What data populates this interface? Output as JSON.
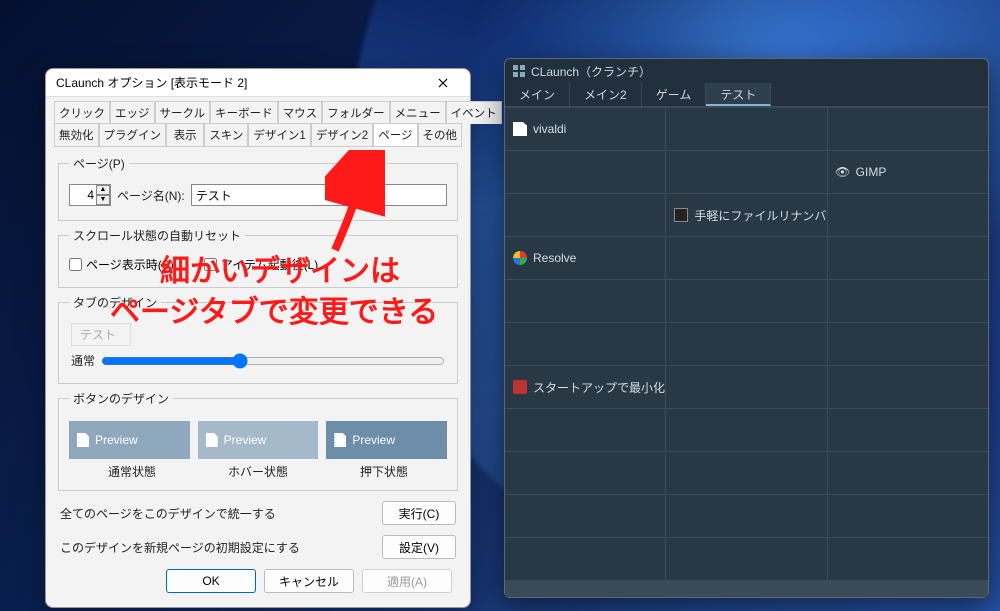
{
  "options": {
    "title": "CLaunch オプション [表示モード 2]",
    "tabs_row1": [
      "クリック",
      "エッジ",
      "サークル",
      "キーボード",
      "マウス",
      "フォルダー",
      "メニュー",
      "イベント"
    ],
    "tabs_row2": [
      "無効化",
      "プラグイン",
      "表示",
      "スキン",
      "デザイン1",
      "デザイン2",
      "ページ",
      "その他"
    ],
    "active_tab": "ページ",
    "page_group": {
      "legend": "ページ(P)",
      "number_value": "4",
      "name_label": "ページ名(N):",
      "name_value": "テスト"
    },
    "scroll_group": {
      "legend": "スクロール状態の自動リセット",
      "cb1": "ページ表示時(S)",
      "cb2": "アイテム起動後(L)"
    },
    "tabdesign_group": {
      "legend": "タブのデザイン",
      "disabled_preview": "テスト",
      "slider_label": "通常"
    },
    "btndesign_group": {
      "legend": "ボタンのデザイン",
      "preview_label": "Preview",
      "state_normal": "通常状態",
      "state_hover": "ホバー状態",
      "state_press": "押下状態"
    },
    "unify": {
      "text": "全てのページをこのデザインで統一する",
      "btn": "実行(C)"
    },
    "newpage": {
      "text": "このデザインを新規ページの初期設定にする",
      "btn": "設定(V)"
    },
    "footer": {
      "ok": "OK",
      "cancel": "キャンセル",
      "apply": "適用(A)"
    }
  },
  "launcher": {
    "title": "CLaunch（クランチ）",
    "tabs": [
      "メイン",
      "メイン2",
      "ゲーム",
      "テスト"
    ],
    "active_tab": "テスト",
    "items": {
      "r0c0": "vivaldi",
      "r1c2": "GIMP",
      "r2c1": "手軽にファイルリナンバー",
      "r3c0": "Resolve",
      "r6c0": "スタートアップで最小化起動コ"
    }
  },
  "annotation": {
    "line1": "細かいデザインは",
    "line2": "ページタブで変更できる"
  }
}
